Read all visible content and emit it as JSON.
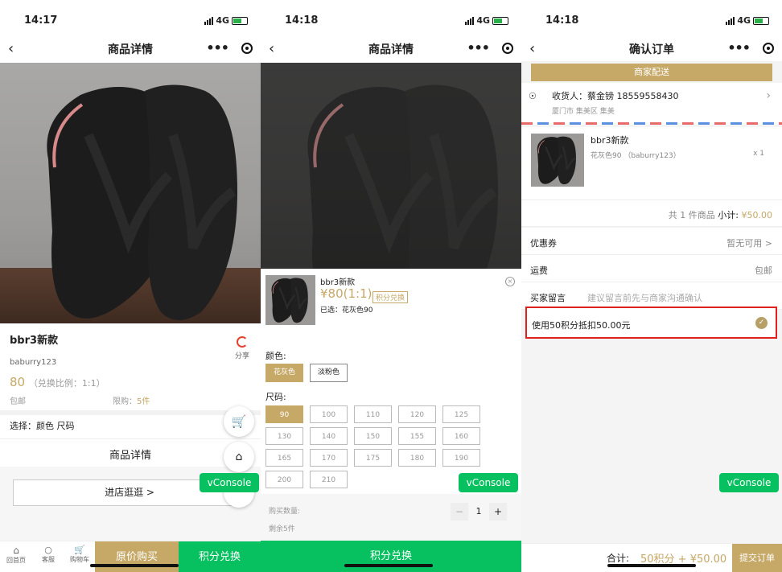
{
  "panel1": {
    "time": "14:17",
    "network": "4G",
    "title": "商品详情",
    "product_name": "bbr3新款",
    "seller": "baburry123",
    "share_label": "分享",
    "price": "80",
    "ratio": "（兑换比例：1:1）",
    "shipping": "包邮",
    "limit_label": "限购：",
    "limit_value": "5件",
    "select_label": "选择：颜色 尺码",
    "details_title": "商品详情",
    "store_button": "进店逛逛 >",
    "vconsole": "vConsole",
    "tabs": [
      "回首页",
      "客服",
      "购物车"
    ],
    "buy_original": "原价购买",
    "redeem": "积分兑换"
  },
  "panel2": {
    "time": "14:18",
    "network": "4G",
    "title": "商品详情",
    "sheet_name": "bbr3新款",
    "sheet_price": "¥80(1:1)",
    "points_tag": "积分兑换",
    "selected": "已选：花灰色90",
    "color_label": "颜色:",
    "colors": [
      "花灰色",
      "淡粉色"
    ],
    "size_label": "尺码:",
    "sizes": [
      "90",
      "100",
      "110",
      "120",
      "125",
      "130",
      "140",
      "150",
      "155",
      "160",
      "165",
      "170",
      "175",
      "180",
      "190",
      "200",
      "210"
    ],
    "qty_label": "购买数量:",
    "qty_minus": "−",
    "qty_value": "1",
    "qty_plus": "+",
    "stock": "剩余5件",
    "vconsole": "vConsole",
    "submit": "积分兑换"
  },
  "panel3": {
    "time": "14:18",
    "network": "4G",
    "title": "确认订单",
    "delivery": "商家配送",
    "receiver": "收货人：蔡金镑 18559558430",
    "address": "厦门市 集美区 集美",
    "item_name": "bbr3新款",
    "item_spec": "花灰色90 （baburry123）",
    "item_qty": "x 1",
    "count_text": "共 1 件商品",
    "subtotal_label": "小计:",
    "subtotal_value": "¥50.00",
    "coupon_label": "优惠券",
    "coupon_value": "暂无可用 >",
    "freight_label": "运费",
    "freight_value": "包邮",
    "note_label": "买家留言",
    "note_placeholder": "建议留言前先与商家沟通确认",
    "points_text": "使用50积分抵扣50.00元",
    "vconsole": "vConsole",
    "total_label": "合计:",
    "total_value": "50积分 + ¥50.00",
    "submit": "提交订单"
  },
  "colors": {
    "gold": "#c6a867",
    "green": "#07c160",
    "highlight": "#e0201a"
  }
}
